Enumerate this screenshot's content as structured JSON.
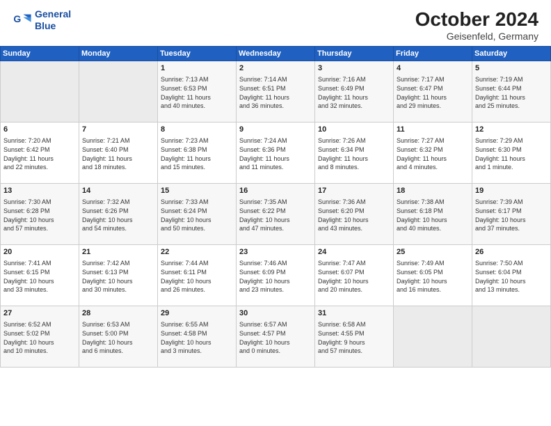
{
  "header": {
    "logo_line1": "General",
    "logo_line2": "Blue",
    "month": "October 2024",
    "location": "Geisenfeld, Germany"
  },
  "days_of_week": [
    "Sunday",
    "Monday",
    "Tuesday",
    "Wednesday",
    "Thursday",
    "Friday",
    "Saturday"
  ],
  "weeks": [
    [
      {
        "day": "",
        "text": ""
      },
      {
        "day": "",
        "text": ""
      },
      {
        "day": "1",
        "text": "Sunrise: 7:13 AM\nSunset: 6:53 PM\nDaylight: 11 hours\nand 40 minutes."
      },
      {
        "day": "2",
        "text": "Sunrise: 7:14 AM\nSunset: 6:51 PM\nDaylight: 11 hours\nand 36 minutes."
      },
      {
        "day": "3",
        "text": "Sunrise: 7:16 AM\nSunset: 6:49 PM\nDaylight: 11 hours\nand 32 minutes."
      },
      {
        "day": "4",
        "text": "Sunrise: 7:17 AM\nSunset: 6:47 PM\nDaylight: 11 hours\nand 29 minutes."
      },
      {
        "day": "5",
        "text": "Sunrise: 7:19 AM\nSunset: 6:44 PM\nDaylight: 11 hours\nand 25 minutes."
      }
    ],
    [
      {
        "day": "6",
        "text": "Sunrise: 7:20 AM\nSunset: 6:42 PM\nDaylight: 11 hours\nand 22 minutes."
      },
      {
        "day": "7",
        "text": "Sunrise: 7:21 AM\nSunset: 6:40 PM\nDaylight: 11 hours\nand 18 minutes."
      },
      {
        "day": "8",
        "text": "Sunrise: 7:23 AM\nSunset: 6:38 PM\nDaylight: 11 hours\nand 15 minutes."
      },
      {
        "day": "9",
        "text": "Sunrise: 7:24 AM\nSunset: 6:36 PM\nDaylight: 11 hours\nand 11 minutes."
      },
      {
        "day": "10",
        "text": "Sunrise: 7:26 AM\nSunset: 6:34 PM\nDaylight: 11 hours\nand 8 minutes."
      },
      {
        "day": "11",
        "text": "Sunrise: 7:27 AM\nSunset: 6:32 PM\nDaylight: 11 hours\nand 4 minutes."
      },
      {
        "day": "12",
        "text": "Sunrise: 7:29 AM\nSunset: 6:30 PM\nDaylight: 11 hours\nand 1 minute."
      }
    ],
    [
      {
        "day": "13",
        "text": "Sunrise: 7:30 AM\nSunset: 6:28 PM\nDaylight: 10 hours\nand 57 minutes."
      },
      {
        "day": "14",
        "text": "Sunrise: 7:32 AM\nSunset: 6:26 PM\nDaylight: 10 hours\nand 54 minutes."
      },
      {
        "day": "15",
        "text": "Sunrise: 7:33 AM\nSunset: 6:24 PM\nDaylight: 10 hours\nand 50 minutes."
      },
      {
        "day": "16",
        "text": "Sunrise: 7:35 AM\nSunset: 6:22 PM\nDaylight: 10 hours\nand 47 minutes."
      },
      {
        "day": "17",
        "text": "Sunrise: 7:36 AM\nSunset: 6:20 PM\nDaylight: 10 hours\nand 43 minutes."
      },
      {
        "day": "18",
        "text": "Sunrise: 7:38 AM\nSunset: 6:18 PM\nDaylight: 10 hours\nand 40 minutes."
      },
      {
        "day": "19",
        "text": "Sunrise: 7:39 AM\nSunset: 6:17 PM\nDaylight: 10 hours\nand 37 minutes."
      }
    ],
    [
      {
        "day": "20",
        "text": "Sunrise: 7:41 AM\nSunset: 6:15 PM\nDaylight: 10 hours\nand 33 minutes."
      },
      {
        "day": "21",
        "text": "Sunrise: 7:42 AM\nSunset: 6:13 PM\nDaylight: 10 hours\nand 30 minutes."
      },
      {
        "day": "22",
        "text": "Sunrise: 7:44 AM\nSunset: 6:11 PM\nDaylight: 10 hours\nand 26 minutes."
      },
      {
        "day": "23",
        "text": "Sunrise: 7:46 AM\nSunset: 6:09 PM\nDaylight: 10 hours\nand 23 minutes."
      },
      {
        "day": "24",
        "text": "Sunrise: 7:47 AM\nSunset: 6:07 PM\nDaylight: 10 hours\nand 20 minutes."
      },
      {
        "day": "25",
        "text": "Sunrise: 7:49 AM\nSunset: 6:05 PM\nDaylight: 10 hours\nand 16 minutes."
      },
      {
        "day": "26",
        "text": "Sunrise: 7:50 AM\nSunset: 6:04 PM\nDaylight: 10 hours\nand 13 minutes."
      }
    ],
    [
      {
        "day": "27",
        "text": "Sunrise: 6:52 AM\nSunset: 5:02 PM\nDaylight: 10 hours\nand 10 minutes."
      },
      {
        "day": "28",
        "text": "Sunrise: 6:53 AM\nSunset: 5:00 PM\nDaylight: 10 hours\nand 6 minutes."
      },
      {
        "day": "29",
        "text": "Sunrise: 6:55 AM\nSunset: 4:58 PM\nDaylight: 10 hours\nand 3 minutes."
      },
      {
        "day": "30",
        "text": "Sunrise: 6:57 AM\nSunset: 4:57 PM\nDaylight: 10 hours\nand 0 minutes."
      },
      {
        "day": "31",
        "text": "Sunrise: 6:58 AM\nSunset: 4:55 PM\nDaylight: 9 hours\nand 57 minutes."
      },
      {
        "day": "",
        "text": ""
      },
      {
        "day": "",
        "text": ""
      }
    ]
  ]
}
